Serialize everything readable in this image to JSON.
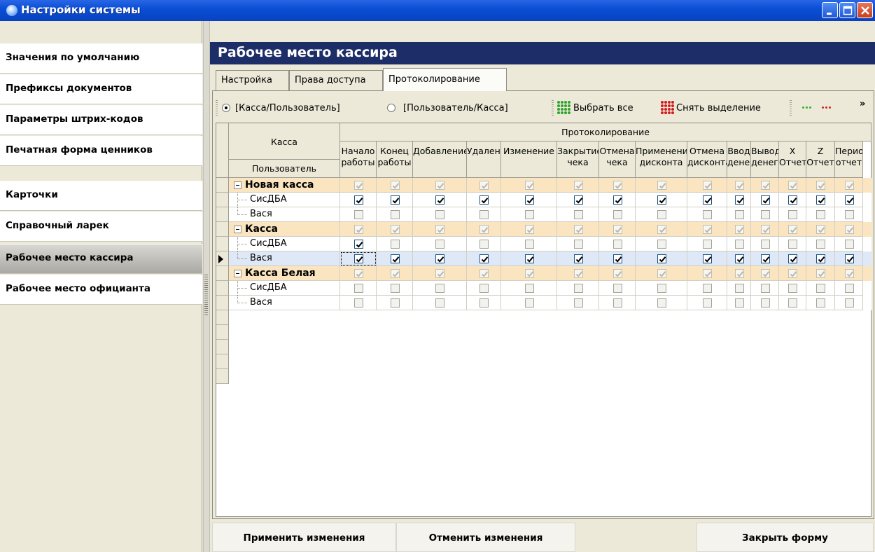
{
  "window": {
    "title": "Настройки системы",
    "icon": "system-settings-icon"
  },
  "nav": {
    "items": [
      {
        "label": "Значения по умолчанию"
      },
      {
        "label": "Префиксы документов"
      },
      {
        "label": "Параметры штрих-кодов"
      },
      {
        "label": "Печатная форма ценников"
      },
      {
        "label": "Карточки"
      },
      {
        "label": "Справочный ларек"
      },
      {
        "label": "Рабочее место кассира",
        "active": true
      },
      {
        "label": "Рабочее место официанта"
      }
    ]
  },
  "header": {
    "title": "Рабочее место кассира"
  },
  "tabs": [
    {
      "label": "Настройка"
    },
    {
      "label": "Права доступа"
    },
    {
      "label": "Протоколирование",
      "active": true
    }
  ],
  "toolbar": {
    "radio1": "[Касса/Пользователь]",
    "radio2": "[Пользователь/Касса]",
    "select_all": "Выбрать все",
    "deselect": "Снять выделение",
    "more": "»"
  },
  "grid": {
    "group_header": "Протоколирование",
    "col_kassa": "Касса",
    "col_user": "Пользователь",
    "columns": [
      {
        "l1": "Начало",
        "l2": "работы"
      },
      {
        "l1": "Конец",
        "l2": "работы"
      },
      {
        "l1": "Добавление",
        "l2": ""
      },
      {
        "l1": "Удаление",
        "l2": ""
      },
      {
        "l1": "Изменение",
        "l2": ""
      },
      {
        "l1": "Закрытие",
        "l2": "чека"
      },
      {
        "l1": "Отмена",
        "l2": "чека"
      },
      {
        "l1": "Применение",
        "l2": "дисконта"
      },
      {
        "l1": "Отмена",
        "l2": "дисконта"
      },
      {
        "l1": "Ввод",
        "l2": "денег"
      },
      {
        "l1": "Вывод",
        "l2": "денег"
      },
      {
        "l1": "X",
        "l2": "Отчет"
      },
      {
        "l1": "Z",
        "l2": "Отчет"
      },
      {
        "l1": "Период.",
        "l2": "отчет"
      }
    ],
    "rows": [
      {
        "type": "group",
        "label": "Новая касса",
        "values": [
          1,
          1,
          1,
          1,
          1,
          1,
          1,
          1,
          1,
          1,
          1,
          1,
          1,
          1
        ]
      },
      {
        "type": "user",
        "label": "СисДБА",
        "values": [
          1,
          1,
          1,
          1,
          1,
          1,
          1,
          1,
          1,
          1,
          1,
          1,
          1,
          1
        ]
      },
      {
        "type": "user",
        "label": "Вася",
        "values": [
          0,
          0,
          0,
          0,
          0,
          0,
          0,
          0,
          0,
          0,
          0,
          0,
          0,
          0
        ]
      },
      {
        "type": "group",
        "label": "Касса",
        "values": [
          1,
          1,
          1,
          1,
          1,
          1,
          1,
          1,
          1,
          1,
          1,
          1,
          1,
          1
        ]
      },
      {
        "type": "user",
        "label": "СисДБА",
        "values": [
          1,
          0,
          0,
          0,
          0,
          0,
          0,
          0,
          0,
          0,
          0,
          0,
          0,
          0
        ]
      },
      {
        "type": "user",
        "label": "Вася",
        "values": [
          1,
          1,
          1,
          1,
          1,
          1,
          1,
          1,
          1,
          1,
          1,
          1,
          1,
          1
        ],
        "current": true
      },
      {
        "type": "group",
        "label": "Касса Белая",
        "values": [
          1,
          1,
          1,
          1,
          1,
          1,
          1,
          1,
          1,
          1,
          1,
          1,
          1,
          1
        ]
      },
      {
        "type": "user",
        "label": "СисДБА",
        "values": [
          0,
          0,
          0,
          0,
          0,
          0,
          0,
          0,
          0,
          0,
          0,
          0,
          0,
          0
        ]
      },
      {
        "type": "user",
        "label": "Вася",
        "values": [
          0,
          0,
          0,
          0,
          0,
          0,
          0,
          0,
          0,
          0,
          0,
          0,
          0,
          0
        ]
      }
    ]
  },
  "buttons": {
    "apply": "Применить изменения",
    "cancel": "Отменить изменения",
    "close": "Закрыть форму"
  },
  "colors": {
    "title_bar": "#0a4fd6",
    "header_bg": "#1c2d67",
    "group_row": "#fae5c0",
    "selected_row": "#dfe8f7",
    "active_nav": "#b9b8b2"
  }
}
